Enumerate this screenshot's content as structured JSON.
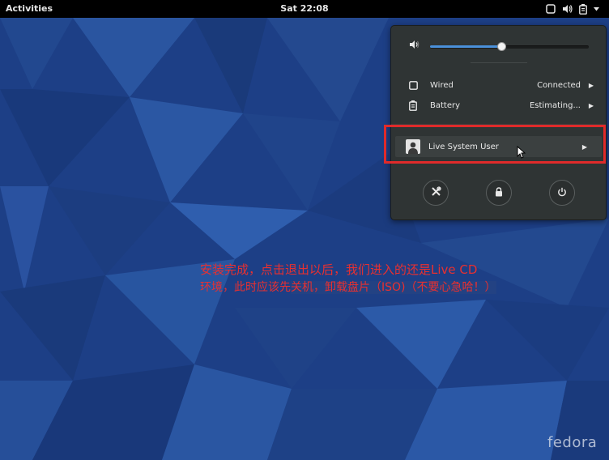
{
  "topbar": {
    "activities_label": "Activities",
    "clock": "Sat 22:08",
    "tray_icons": [
      "window-icon",
      "speaker-icon",
      "battery-icon"
    ]
  },
  "system_menu": {
    "volume": {
      "icon": "speaker-icon",
      "level_fraction": 0.45
    },
    "network": {
      "icon": "wired-network-icon",
      "label": "Wired",
      "status": "Connected"
    },
    "battery": {
      "icon": "battery-icon",
      "label": "Battery",
      "status": "Estimating..."
    },
    "user": {
      "icon": "avatar-icon",
      "label": "Live System User"
    },
    "actions": [
      "settings-icon",
      "lock-icon",
      "power-icon"
    ]
  },
  "annotation": {
    "line1": "安装完成，点击退出以后，我们进入的还是Live CD",
    "line2_a": "环境，此时应该先",
    "line2_b": "关机，卸载盘片（ISO)（不要心急哈！）"
  },
  "branding": {
    "logo_text": "fedora"
  },
  "colors": {
    "accent": "#4a90d9",
    "annotation_red": "#e83030",
    "highlight_box": "#e02a2a",
    "wallpaper_base": "#1d3f86"
  }
}
